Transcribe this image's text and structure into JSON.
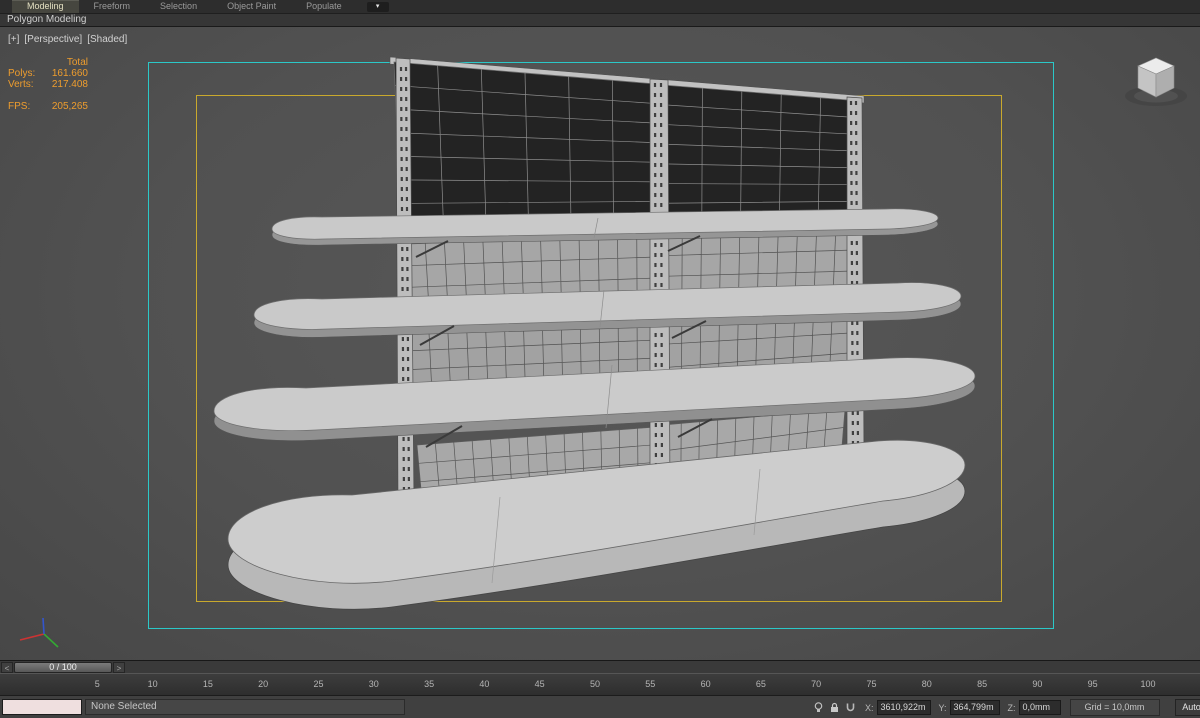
{
  "ribbon": {
    "tabs": [
      {
        "label": "Modeling",
        "active": true
      },
      {
        "label": "Freeform",
        "active": false
      },
      {
        "label": "Selection",
        "active": false
      },
      {
        "label": "Object Paint",
        "active": false
      },
      {
        "label": "Populate",
        "active": false
      }
    ],
    "config_icon": "▾",
    "panel_label": "Polygon Modeling"
  },
  "viewport": {
    "labels": {
      "general": "[+]",
      "pov": "[Perspective]",
      "shading": "[Shaded]"
    },
    "stats": {
      "total_label": "Total",
      "polys_label": "Polys:",
      "polys": "161.660",
      "verts_label": "Verts:",
      "verts": "217.408",
      "fps_label": "FPS:",
      "fps": "205,265"
    }
  },
  "timeline": {
    "prev_arrow": "<",
    "next_arrow": ">",
    "frame_indicator": "0 / 100",
    "ticks": [
      5,
      10,
      15,
      20,
      25,
      30,
      35,
      40,
      45,
      50,
      55,
      60,
      65,
      70,
      75,
      80,
      85,
      90,
      95,
      100
    ]
  },
  "status_bar": {
    "listener_value": "",
    "prompt": "None Selected",
    "coords": {
      "x_label": "X:",
      "x": "3610,922m",
      "y_label": "Y:",
      "y": "364,799m",
      "z_label": "Z:",
      "z": "0,0mm"
    },
    "grid": "Grid = 10,0mm",
    "auto_key": "Auto"
  },
  "colors": {
    "safe_frame_action": "#2bc8c8",
    "safe_frame_title": "#c9a92d",
    "stats_text": "#ee9d2e",
    "viewport_bg": "#515151",
    "listener_bg": "#efdfdf"
  }
}
